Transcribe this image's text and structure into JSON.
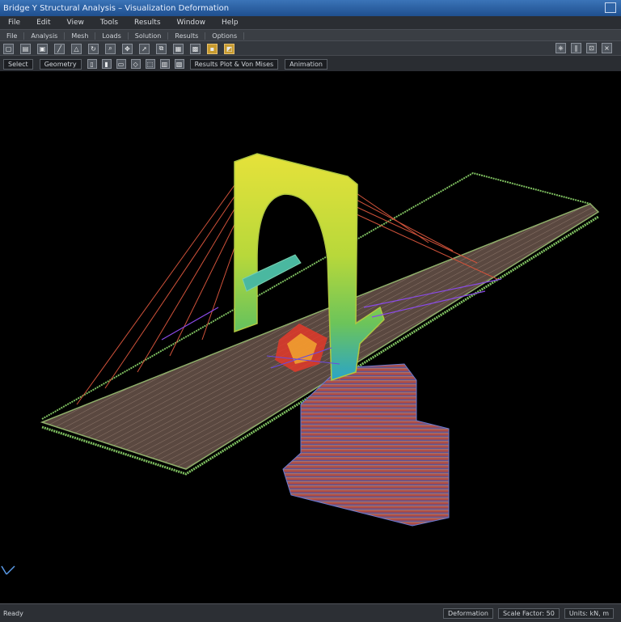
{
  "window": {
    "title": "Bridge Y Structural Analysis – Visualization Deformation"
  },
  "menu": [
    "File",
    "Edit",
    "View",
    "Tools",
    "Results",
    "Window",
    "Help"
  ],
  "toolbar1": [
    "File",
    "Analysis",
    "Mesh",
    "Loads",
    "Solution",
    "Results",
    "Options"
  ],
  "toolbar2_right": [
    "⎈",
    "∥",
    "⊡",
    "×"
  ],
  "toolbar3": {
    "first": "Select",
    "second": "Geometry",
    "display_label": "Results Plot & Von Mises",
    "last": "Animation"
  },
  "status": {
    "left": "Ready",
    "mid": "Deformation",
    "scale": "Scale Factor: 50",
    "units": "Units: kN, m"
  },
  "colors": {
    "titlebar": "#2a5fa3",
    "arch_high": "#e6e23a",
    "arch_mid": "#79c84a",
    "arch_low": "#2aa4c8",
    "stress_peak": "#e23a2a",
    "cable": "#d0523a",
    "deck": "#6b5548"
  },
  "icons": [
    "new-icon",
    "open-icon",
    "save-icon",
    "pencil-icon",
    "measure-icon",
    "rotate-icon",
    "zoom-icon",
    "pan-icon",
    "select-icon",
    "copy-icon",
    "mesh-icon",
    "grid-icon",
    "warm-highlight-icon",
    "image-icon"
  ]
}
